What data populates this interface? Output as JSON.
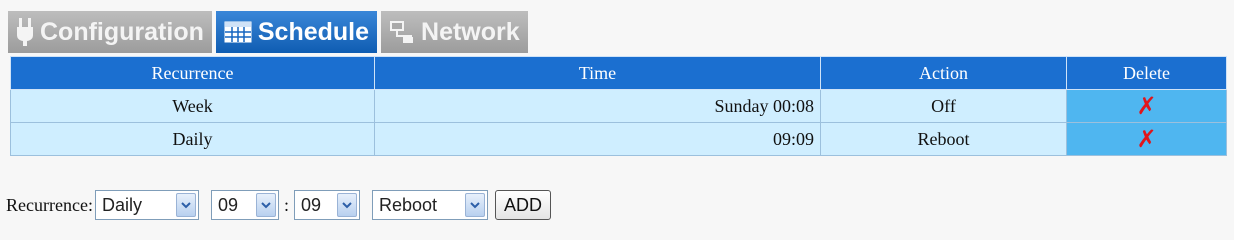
{
  "tabs": [
    {
      "label": "Configuration",
      "icon": "plug-icon",
      "active": false
    },
    {
      "label": "Schedule",
      "icon": "calendar-icon",
      "active": true
    },
    {
      "label": "Network",
      "icon": "network-icon",
      "active": false
    }
  ],
  "table": {
    "headers": [
      "Recurrence",
      "Time",
      "Action",
      "Delete"
    ],
    "rows": [
      {
        "recurrence": "Week",
        "time": "Sunday 00:08",
        "action": "Off",
        "delete": "✗"
      },
      {
        "recurrence": "Daily",
        "time": "09:09",
        "action": "Reboot",
        "delete": "✗"
      }
    ]
  },
  "form": {
    "recurrence_label": "Recurrence:",
    "recurrence_value": "Daily",
    "hour_value": "09",
    "separator": ":",
    "minute_value": "09",
    "action_value": "Reboot",
    "add_label": "ADD"
  },
  "colors": {
    "header": "#1b6fd0",
    "row": "#cfeeff",
    "delete_cell": "#4fb6f0",
    "delete_mark": "#e0151b",
    "tab_active": "#1565c0",
    "tab_inactive": "#a9a9a9"
  }
}
